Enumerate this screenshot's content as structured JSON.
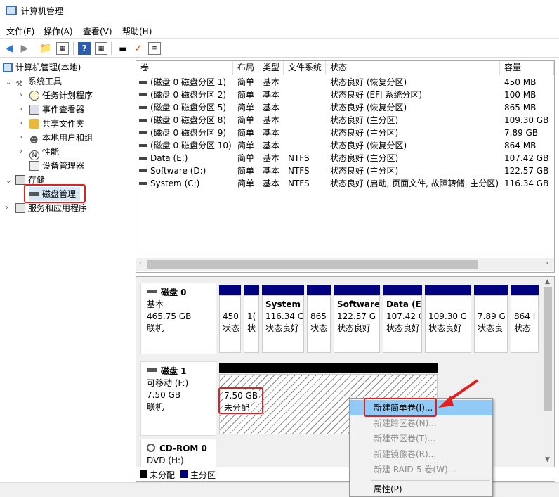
{
  "window": {
    "title": "计算机管理"
  },
  "menu": [
    "文件(F)",
    "操作(A)",
    "查看(V)",
    "帮助(H)"
  ],
  "toolbar": {
    "icons": [
      "back-icon",
      "forward-icon",
      "up-folder-icon",
      "show-hide-tree-icon",
      "help-icon",
      "properties-icon",
      "connect-icon",
      "check-icon",
      "list-icon"
    ]
  },
  "tree": {
    "root": "计算机管理(本地)",
    "system_tools": "系统工具",
    "task_scheduler": "任务计划程序",
    "event_viewer": "事件查看器",
    "shared_folders": "共享文件夹",
    "local_users": "本地用户和组",
    "performance": "性能",
    "device_manager": "设备管理器",
    "storage": "存储",
    "disk_management": "磁盘管理",
    "services_apps": "服务和应用程序"
  },
  "volumes": {
    "headers": [
      "卷",
      "布局",
      "类型",
      "文件系统",
      "状态",
      "容量"
    ],
    "rows": [
      [
        "(磁盘 0 磁盘分区 1)",
        "简单",
        "基本",
        "",
        "状态良好 (恢复分区)",
        "450 MB"
      ],
      [
        "(磁盘 0 磁盘分区 2)",
        "简单",
        "基本",
        "",
        "状态良好 (EFI 系统分区)",
        "100 MB"
      ],
      [
        "(磁盘 0 磁盘分区 5)",
        "简单",
        "基本",
        "",
        "状态良好 (恢复分区)",
        "865 MB"
      ],
      [
        "(磁盘 0 磁盘分区 8)",
        "简单",
        "基本",
        "",
        "状态良好 (主分区)",
        "109.30 GB"
      ],
      [
        "(磁盘 0 磁盘分区 9)",
        "简单",
        "基本",
        "",
        "状态良好 (主分区)",
        "7.89 GB"
      ],
      [
        "(磁盘 0 磁盘分区 10)",
        "简单",
        "基本",
        "",
        "状态良好 (恢复分区)",
        "864 MB"
      ],
      [
        "Data (E:)",
        "简单",
        "基本",
        "NTFS",
        "状态良好 (主分区)",
        "107.42 GB"
      ],
      [
        "Software (D:)",
        "简单",
        "基本",
        "NTFS",
        "状态良好 (主分区)",
        "122.57 GB"
      ],
      [
        "System (C:)",
        "简单",
        "基本",
        "NTFS",
        "状态良好 (启动, 页面文件, 故障转储, 主分区)",
        "116.34 GB"
      ]
    ]
  },
  "disk0": {
    "name": "磁盘 0",
    "type": "基本",
    "size": "465.75 GB",
    "status": "联机",
    "parts": [
      {
        "l1": "",
        "l2": "450",
        "l3": "状态"
      },
      {
        "l1": "",
        "l2": "1(",
        "l3": "状"
      },
      {
        "l1": "System",
        "l2": "116.34 G",
        "l3": "状态良好"
      },
      {
        "l1": "",
        "l2": "865",
        "l3": "状态"
      },
      {
        "l1": "Software",
        "l2": "122.57 G",
        "l3": "状态良好"
      },
      {
        "l1": "Data (E",
        "l2": "107.42 G",
        "l3": "状态良好"
      },
      {
        "l1": "",
        "l2": "109.30 G",
        "l3": "状态良好"
      },
      {
        "l1": "",
        "l2": "7.89 G",
        "l3": "状态良"
      },
      {
        "l1": "",
        "l2": "864 I",
        "l3": "状态"
      }
    ]
  },
  "disk1": {
    "name": "磁盘 1",
    "type": "可移动 (F:)",
    "size": "7.50 GB",
    "status": "联机",
    "unalloc_size": "7.50 GB",
    "unalloc_label": "未分配"
  },
  "cdrom": {
    "name": "CD-ROM 0",
    "type": "DVD (H:)"
  },
  "legend": {
    "unallocated": "未分配",
    "primary": "主分区"
  },
  "context_menu": [
    "新建简单卷(I)...",
    "新建跨区卷(N)...",
    "新建带区卷(T)...",
    "新建镜像卷(R)...",
    "新建 RAID-5 卷(W)...",
    "属性(P)"
  ],
  "colors": {
    "primary": "#000080",
    "unallocated": "#000000",
    "highlight": "#91c9f7",
    "annotation": "#e02020"
  }
}
